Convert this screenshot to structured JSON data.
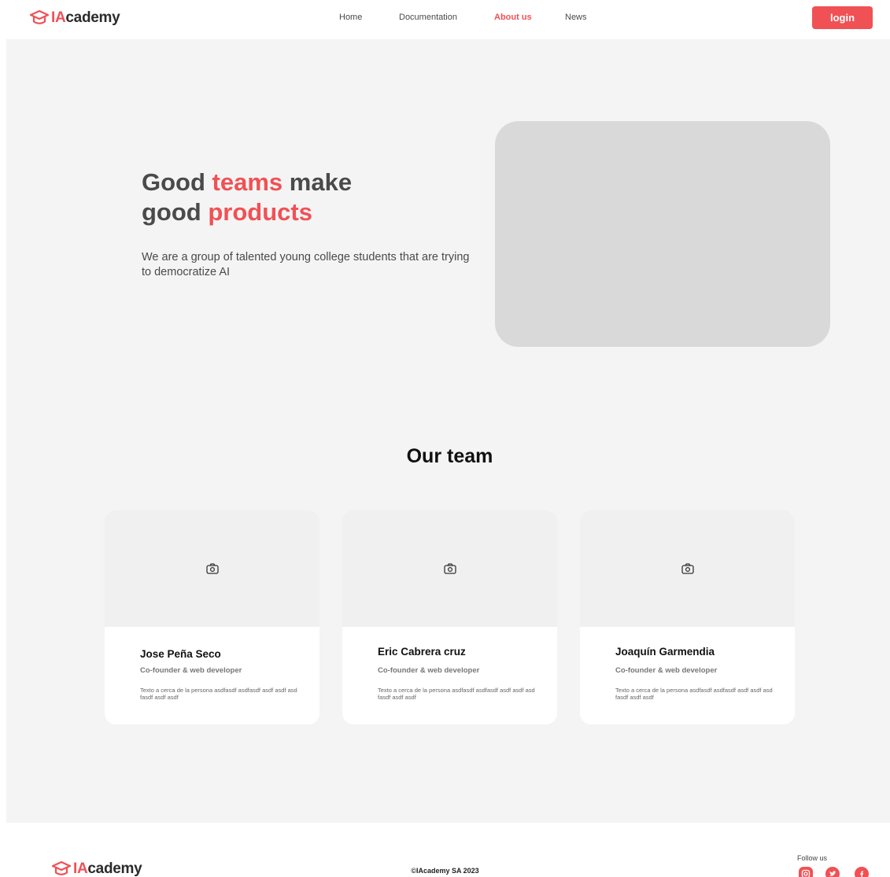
{
  "brand": {
    "logo_prefix": "IA",
    "logo_suffix": "cademy",
    "accent_color": "#f05155"
  },
  "nav": {
    "items": [
      {
        "label": "Home",
        "active": false
      },
      {
        "label": "Documentation",
        "active": false
      },
      {
        "label": "About us",
        "active": true
      },
      {
        "label": "News",
        "active": false
      }
    ],
    "login_label": "login"
  },
  "hero": {
    "title_part1": "Good ",
    "title_accent1": "teams",
    "title_part2": " make",
    "title_part3": "good ",
    "title_accent2": "products",
    "description": "We are a group of talented young college students that are trying to democratize AI"
  },
  "team": {
    "title": "Our team",
    "members": [
      {
        "name": "Jose Peña Seco",
        "role": "Co-founder & web developer",
        "bio": "Texto a cerca de la persona asdfasdf asdfasdf asdf asdf asd fasdf asdf asdf"
      },
      {
        "name": "Eric Cabrera cruz",
        "role": "Co-founder & web developer",
        "bio": "Texto a cerca de la persona asdfasdf asdfasdf asdf asdf asd fasdf asdf asdf"
      },
      {
        "name": "Joaquín Garmendia",
        "role": "Co-founder & web developer",
        "bio": "Texto a cerca de la persona asdfasdf asdfasdf asdf asdf asd fasdf asdf asdf"
      }
    ]
  },
  "footer": {
    "copyright": "©IAcademy SA 2023",
    "follow_label": "Follow us",
    "social_icons": [
      "instagram-icon",
      "twitter-icon",
      "facebook-icon"
    ]
  }
}
